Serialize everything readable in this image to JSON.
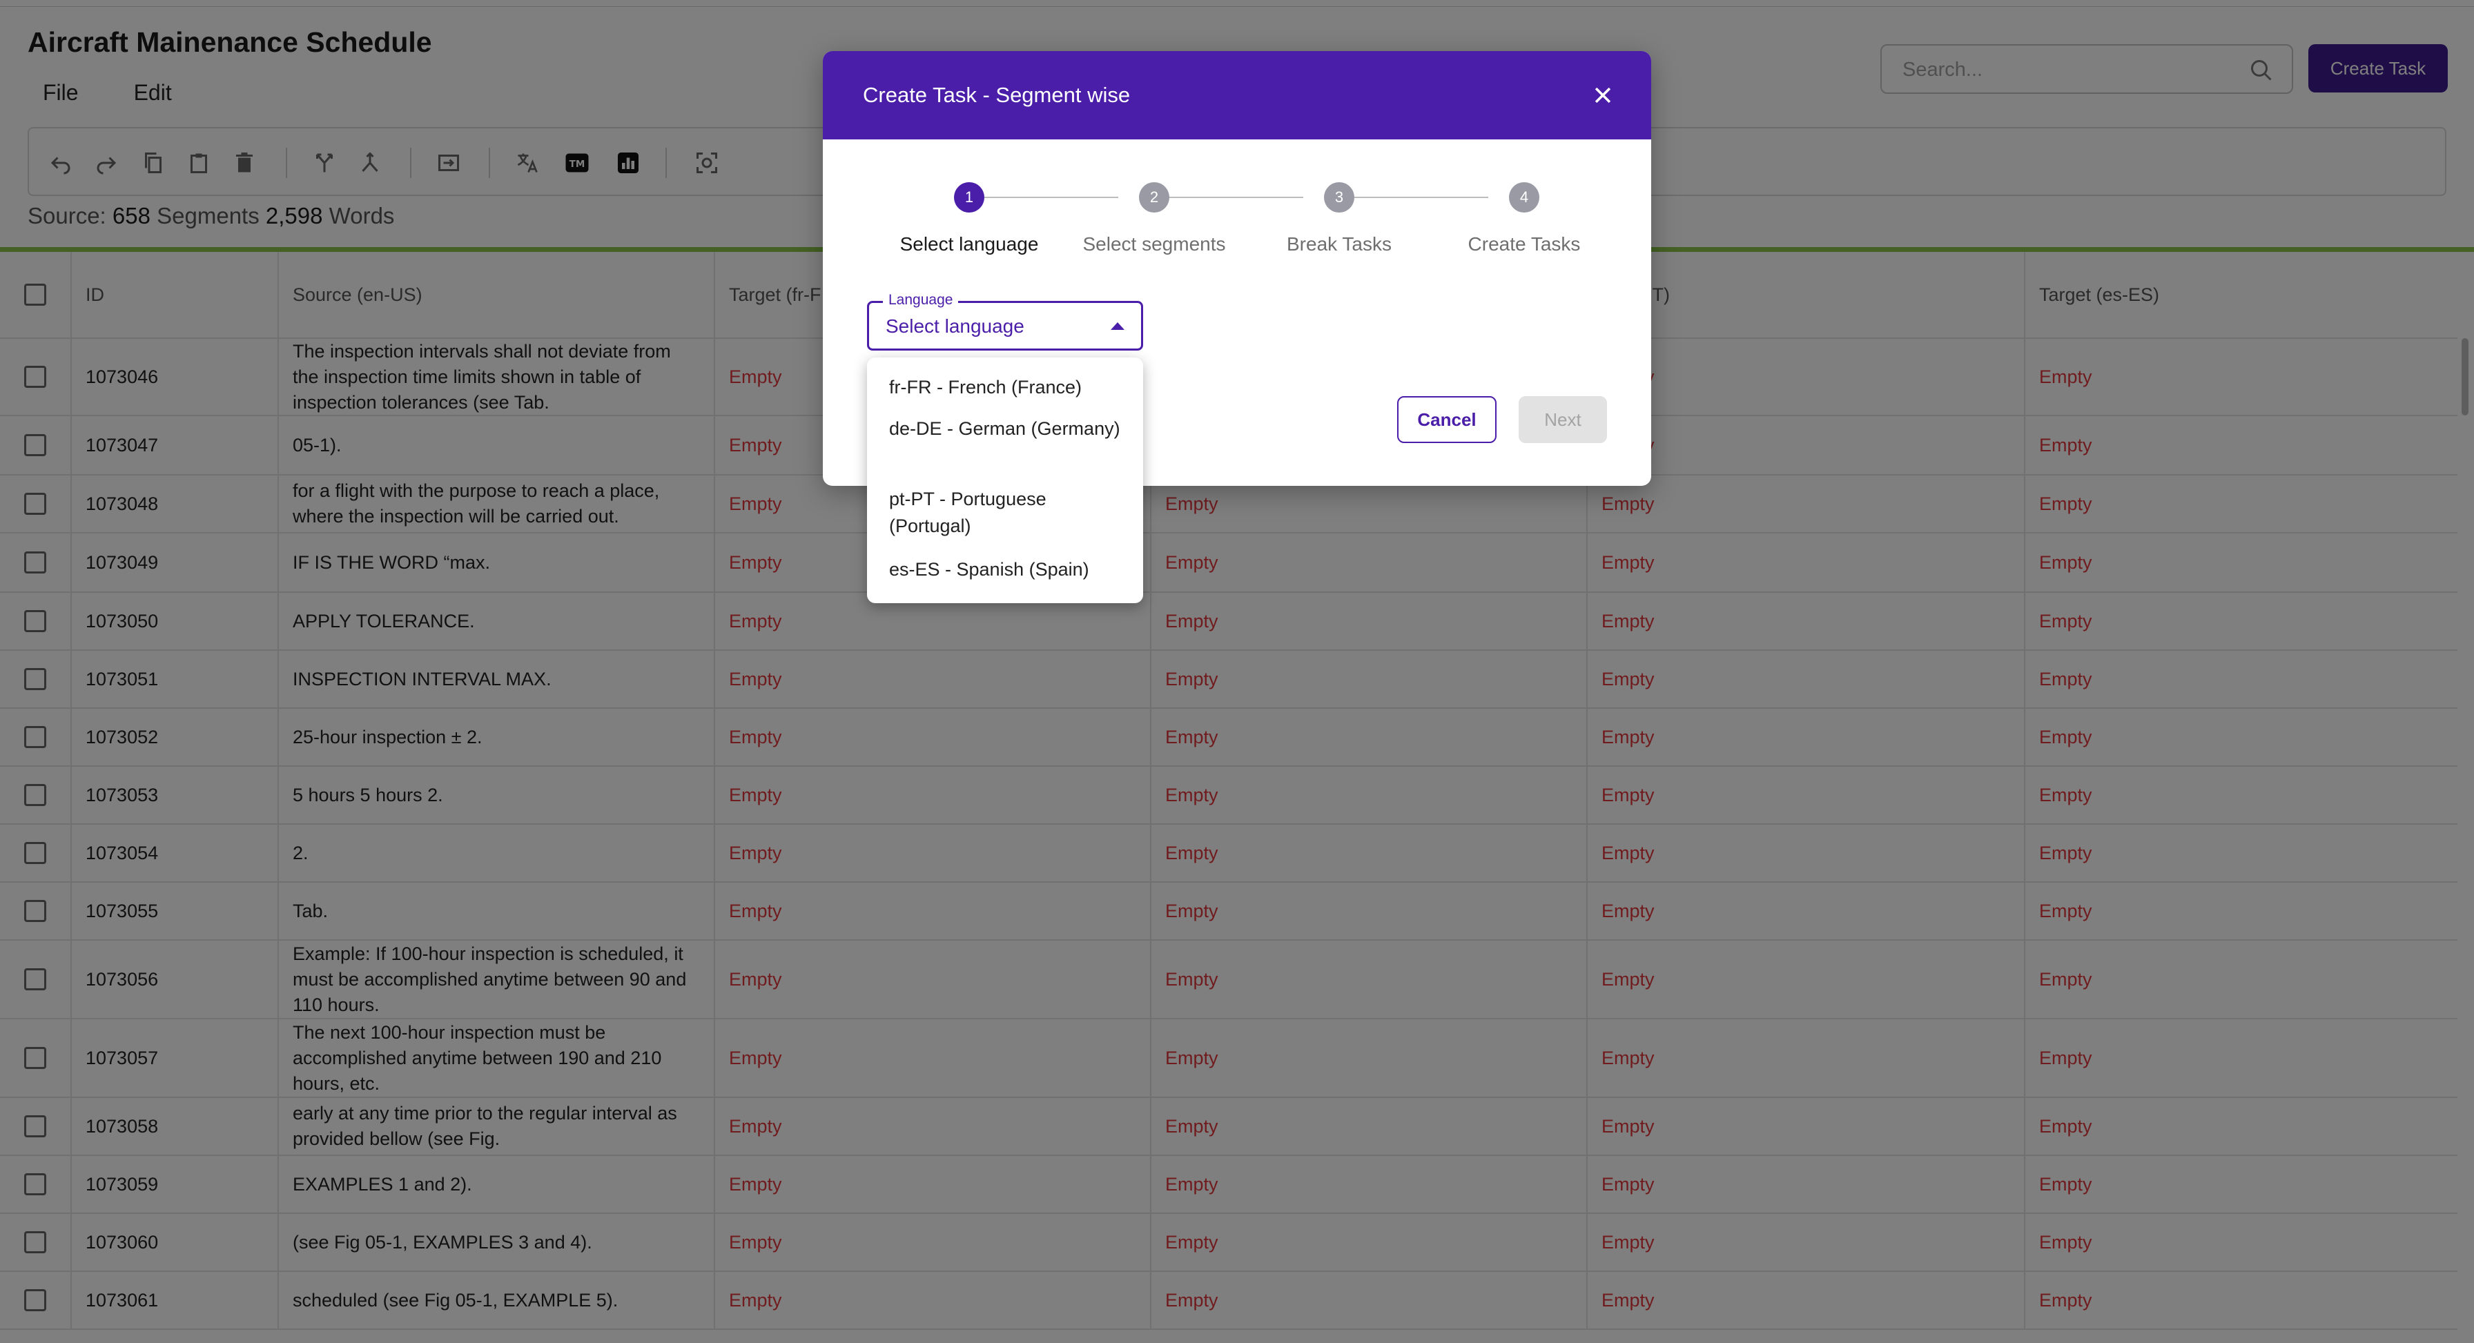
{
  "app": {
    "title": "Aircraft Mainenance Schedule",
    "menu": [
      "File",
      "Edit"
    ],
    "search_placeholder": "Search...",
    "create_task_label": "Create Task",
    "accent_color": "#3d1a8c"
  },
  "toolbar": {
    "icons": [
      "undo-icon",
      "redo-icon",
      "copy-icon",
      "paste-icon",
      "delete-icon",
      "split-icon",
      "merge-icon",
      "insert-icon",
      "translate-icon",
      "tm-icon",
      "stats-icon",
      "screenshot-icon"
    ],
    "tm_label": "TM"
  },
  "stats": {
    "source_label": "Source:",
    "segments_count": "658",
    "segments_label": "Segments",
    "words_count": "2,598",
    "words_label": "Words"
  },
  "table": {
    "headers": [
      "ID",
      "Source (en-US)",
      "Target (fr-F",
      "",
      "t (pt-PT)",
      "Target (es-ES)"
    ],
    "empty_label": "Empty",
    "rows": [
      {
        "id": "1073046",
        "source": "The inspection intervals shall not deviate from the inspection time limits shown in table of inspection tolerances (see Tab."
      },
      {
        "id": "1073047",
        "source": "05-1)."
      },
      {
        "id": "1073048",
        "source": "for a flight with the purpose to reach a place, where the inspection will be carried out."
      },
      {
        "id": "1073049",
        "source": "IF IS THE WORD “max."
      },
      {
        "id": "1073050",
        "source": "APPLY TOLERANCE."
      },
      {
        "id": "1073051",
        "source": "INSPECTION INTERVAL MAX."
      },
      {
        "id": "1073052",
        "source": "25-hour inspection ± 2."
      },
      {
        "id": "1073053",
        "source": "5 hours 5 hours 2."
      },
      {
        "id": "1073054",
        "source": "2."
      },
      {
        "id": "1073055",
        "source": "Tab."
      },
      {
        "id": "1073056",
        "source": "Example: If 100-hour inspection is scheduled, it must be accomplished anytime between 90 and 110 hours."
      },
      {
        "id": "1073057",
        "source": "The next 100-hour inspection must be accomplished anytime between 190 and 210 hours, etc."
      },
      {
        "id": "1073058",
        "source": "early at any time prior to the regular interval as provided bellow (see Fig."
      },
      {
        "id": "1073059",
        "source": "EXAMPLES 1 and 2)."
      },
      {
        "id": "1073060",
        "source": "(see Fig 05-1, EXAMPLES 3 and 4)."
      },
      {
        "id": "1073061",
        "source": "scheduled (see Fig 05-1, EXAMPLE 5)."
      }
    ]
  },
  "dialog": {
    "title": "Create Task - Segment wise",
    "steps": [
      {
        "number": "1",
        "label": "Select language"
      },
      {
        "number": "2",
        "label": "Select segments"
      },
      {
        "number": "3",
        "label": "Break Tasks"
      },
      {
        "number": "4",
        "label": "Create Tasks"
      }
    ],
    "active_step": 1,
    "language_field": {
      "label": "Language",
      "placeholder": "Select language"
    },
    "language_options": [
      "fr-FR - French (France)",
      "de-DE - German (Germany)",
      "pt-PT - Portuguese (Portugal)",
      "es-ES - Spanish (Spain)"
    ],
    "cancel_label": "Cancel",
    "next_label": "Next",
    "header_color": "#4a1ea8"
  }
}
